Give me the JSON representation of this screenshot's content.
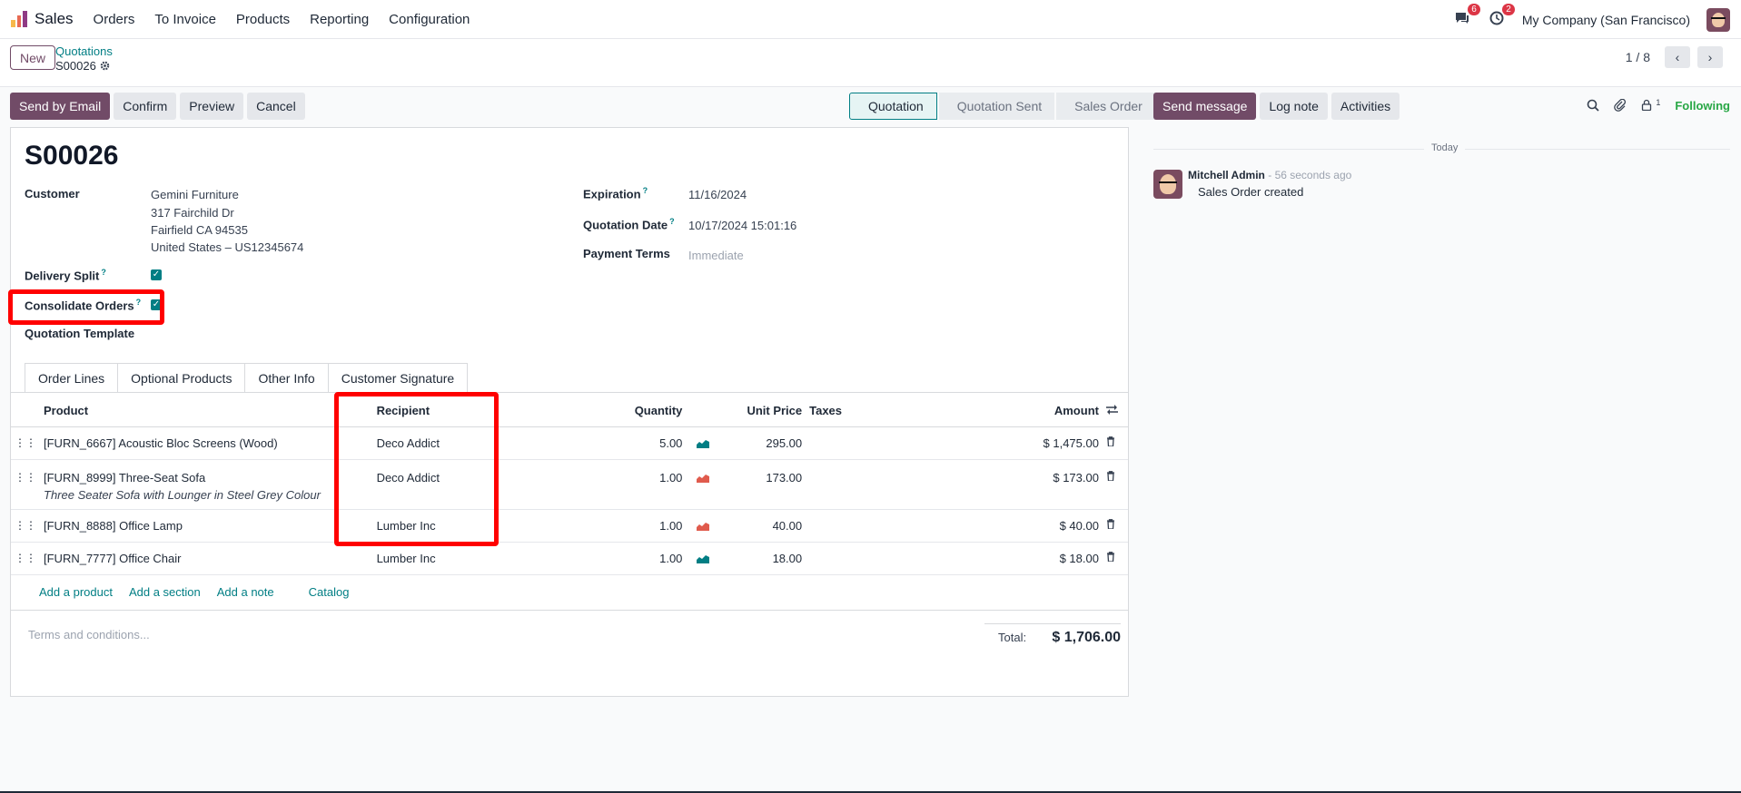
{
  "topbar": {
    "app_name": "Sales",
    "menu": [
      "Orders",
      "To Invoice",
      "Products",
      "Reporting",
      "Configuration"
    ],
    "messages_badge": "6",
    "activities_badge": "2",
    "company": "My Company (San Francisco)"
  },
  "control": {
    "new_label": "New",
    "breadcrumb_parent": "Quotations",
    "breadcrumb_current": "S00026",
    "pager_value": "1 / 8"
  },
  "actions": {
    "send_email": "Send by Email",
    "confirm": "Confirm",
    "preview": "Preview",
    "cancel": "Cancel"
  },
  "status": {
    "steps": [
      "Quotation",
      "Quotation Sent",
      "Sales Order"
    ],
    "active": "Quotation"
  },
  "form": {
    "title": "S00026",
    "customer_label": "Customer",
    "customer_name": "Gemini Furniture",
    "customer_addr1": "317 Fairchild Dr",
    "customer_addr2": "Fairfield CA 94535",
    "customer_addr3": "United States – US12345674",
    "delivery_split_label": "Delivery Split",
    "consolidate_label": "Consolidate Orders",
    "template_label": "Quotation Template",
    "expiration_label": "Expiration",
    "expiration_value": "11/16/2024",
    "quotation_date_label": "Quotation Date",
    "quotation_date_value": "10/17/2024 15:01:16",
    "payment_terms_label": "Payment Terms",
    "payment_terms_placeholder": "Immediate",
    "help_mark": "?"
  },
  "tabs": [
    "Order Lines",
    "Optional Products",
    "Other Info",
    "Customer Signature"
  ],
  "lines": {
    "headers": {
      "product": "Product",
      "recipient": "Recipient",
      "quantity": "Quantity",
      "unit_price": "Unit Price",
      "taxes": "Taxes",
      "amount": "Amount"
    },
    "rows": [
      {
        "product": "[FURN_6667] Acoustic Bloc Screens (Wood)",
        "description": "",
        "recipient": "Deco Addict",
        "quantity": "5.00",
        "unit_price": "295.00",
        "amount": "$ 1,475.00",
        "forecast_color": "#017e84"
      },
      {
        "product": "[FURN_8999] Three-Seat Sofa",
        "description": "Three Seater Sofa with Lounger in Steel Grey Colour",
        "recipient": "Deco Addict",
        "quantity": "1.00",
        "unit_price": "173.00",
        "amount": "$ 173.00",
        "forecast_color": "#e05b4d"
      },
      {
        "product": "[FURN_8888] Office Lamp",
        "description": "",
        "recipient": "Lumber Inc",
        "quantity": "1.00",
        "unit_price": "40.00",
        "amount": "$ 40.00",
        "forecast_color": "#e05b4d"
      },
      {
        "product": "[FURN_7777] Office Chair",
        "description": "",
        "recipient": "Lumber Inc",
        "quantity": "1.00",
        "unit_price": "18.00",
        "amount": "$ 18.00",
        "forecast_color": "#017e84"
      }
    ],
    "add_product": "Add a product",
    "add_section": "Add a section",
    "add_note": "Add a note",
    "catalog": "Catalog",
    "terms_placeholder": "Terms and conditions...",
    "total_label": "Total:",
    "total_value": "$ 1,706.00"
  },
  "chatter": {
    "send_message": "Send message",
    "log_note": "Log note",
    "activities": "Activities",
    "followers_count": "1",
    "following": "Following",
    "today": "Today",
    "author": "Mitchell Admin",
    "time": "- 56 seconds ago",
    "body": "Sales Order created"
  },
  "colors": {
    "brand": "#714b67",
    "accent": "#017e84",
    "highlight": "#ff0000"
  }
}
